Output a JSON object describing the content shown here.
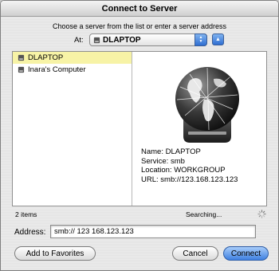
{
  "window": {
    "title": "Connect to Server"
  },
  "instruction": "Choose a server from the list or enter a server address",
  "at": {
    "label": "At:",
    "selected": "DLAPTOP"
  },
  "servers": [
    {
      "name": "DLAPTOP",
      "selected": true
    },
    {
      "name": "Inara's Computer",
      "selected": false
    }
  ],
  "preview": {
    "name": "Name: DLAPTOP",
    "service": "Service: smb",
    "location": "Location: WORKGROUP",
    "url": "URL: smb://123.168.123.123"
  },
  "status": {
    "count": "2 items",
    "state": "Searching..."
  },
  "address": {
    "label": "Address:",
    "value": "smb:// 123 168.123.123"
  },
  "buttons": {
    "favorites": "Add to Favorites",
    "cancel": "Cancel",
    "connect": "Connect"
  },
  "colors": {
    "selection": "#f7f3a6",
    "accent": "#3e80e0"
  }
}
